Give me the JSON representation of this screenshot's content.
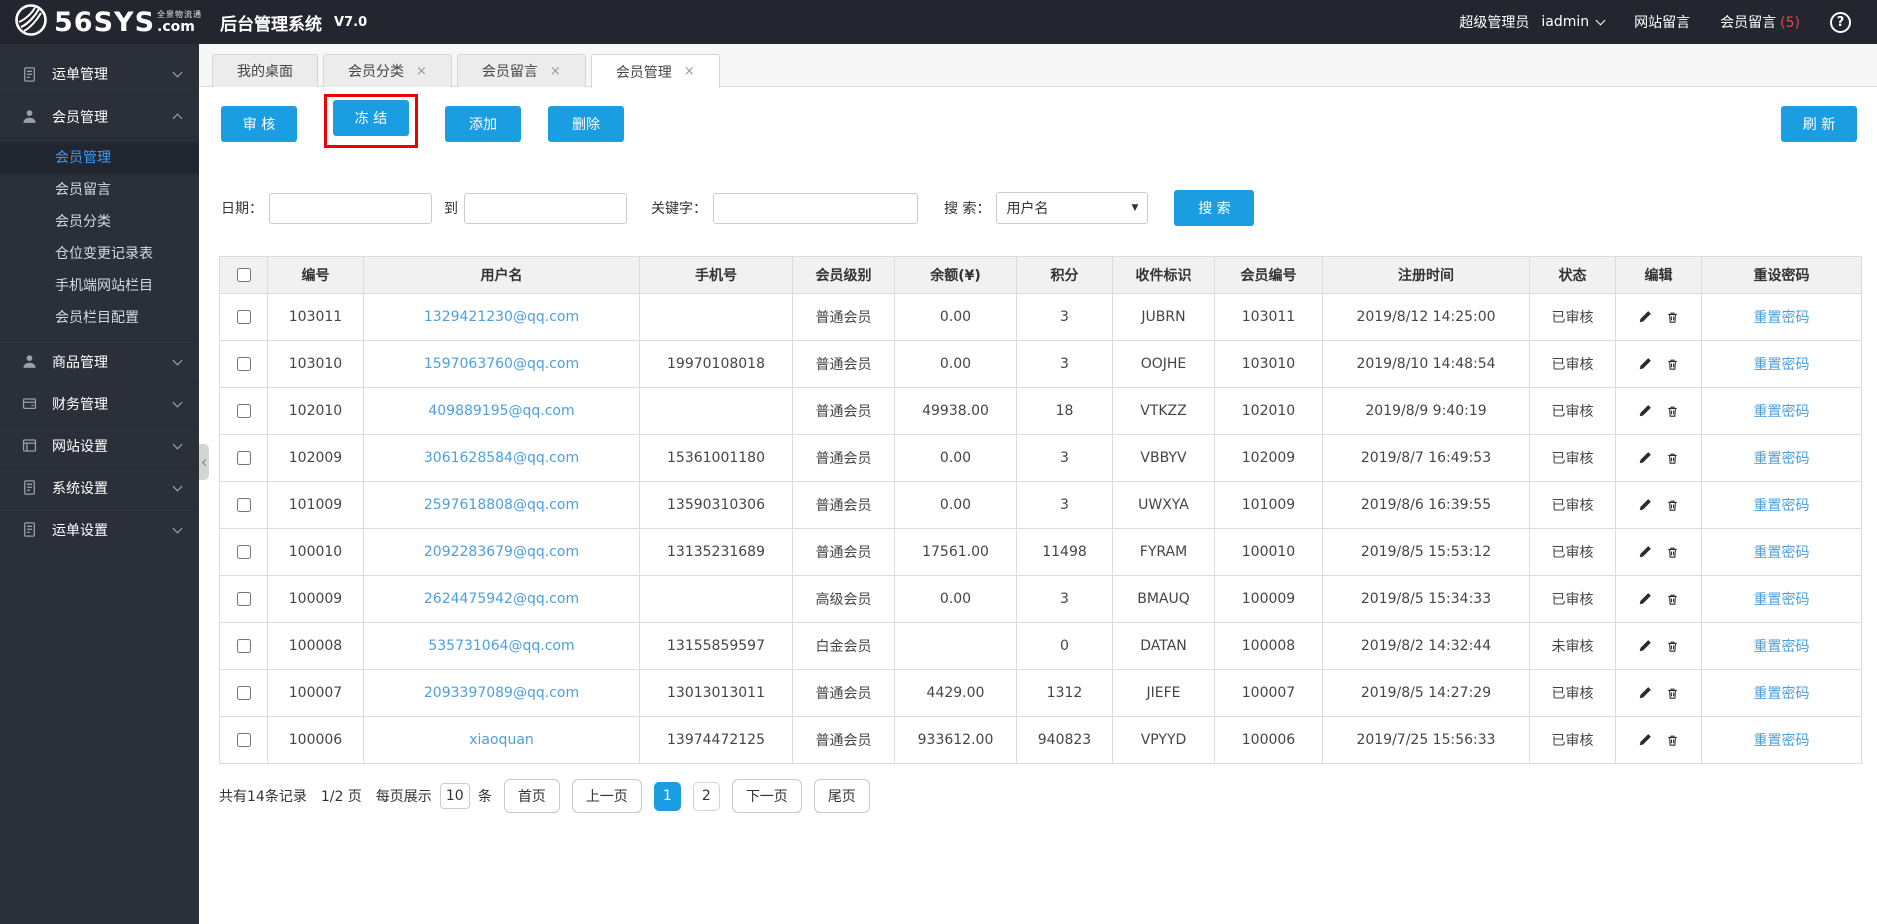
{
  "colors": {
    "accent_blue": "#1b9de2",
    "link_blue": "#4e9fdd",
    "annotation_red": "#f00000",
    "header_dark": "#23262e",
    "sidebar_dark": "#2b2f39",
    "active_menu_blue": "#3d9bf0",
    "count_red": "#e64545"
  },
  "header": {
    "logo_main": "56SYS",
    "logo_sub_top": "全景物流通",
    "logo_sub_bottom": ".com",
    "app_title": "后台管理系统",
    "version": "V7.0",
    "role": "超级管理员",
    "username": "iadmin",
    "site_messages": "网站留言",
    "member_messages": "会员留言",
    "member_messages_count": "(5)",
    "help": "?"
  },
  "sidebar": {
    "items": [
      {
        "label": "运单管理",
        "icon": "document-icon",
        "expanded": false
      },
      {
        "label": "会员管理",
        "icon": "user-icon",
        "expanded": true,
        "children": [
          {
            "label": "会员管理",
            "active": true
          },
          {
            "label": "会员留言",
            "active": false
          },
          {
            "label": "会员分类",
            "active": false
          },
          {
            "label": "仓位变更记录表",
            "active": false
          },
          {
            "label": "手机端网站栏目",
            "active": false
          },
          {
            "label": "会员栏目配置",
            "active": false
          }
        ]
      },
      {
        "label": "商品管理",
        "icon": "user-icon",
        "expanded": false
      },
      {
        "label": "财务管理",
        "icon": "wallet-icon",
        "expanded": false
      },
      {
        "label": "网站设置",
        "icon": "browser-icon",
        "expanded": false
      },
      {
        "label": "系统设置",
        "icon": "document-icon",
        "expanded": false
      },
      {
        "label": "运单设置",
        "icon": "document-icon",
        "expanded": false
      }
    ]
  },
  "tabs": [
    {
      "label": "我的桌面",
      "closable": false,
      "active": false
    },
    {
      "label": "会员分类",
      "closable": true,
      "active": false
    },
    {
      "label": "会员留言",
      "closable": true,
      "active": false
    },
    {
      "label": "会员管理",
      "closable": true,
      "active": true
    }
  ],
  "toolbar": {
    "audit": "审 核",
    "freeze": "冻 结",
    "add": "添加",
    "delete": "删除",
    "refresh": "刷 新"
  },
  "filters": {
    "date_label": "日期：",
    "to_label": "到",
    "keyword_label": "关键字：",
    "search_by_label": "搜 索：",
    "search_select_value": "用户名",
    "search_button": "搜 索"
  },
  "table": {
    "columns": [
      "编号",
      "用户名",
      "手机号",
      "会员级别",
      "余额(¥)",
      "积分",
      "收件标识",
      "会员编号",
      "注册时间",
      "状态",
      "编辑",
      "重设密码"
    ],
    "reset_link_label": "重置密码",
    "rows": [
      {
        "id": "103011",
        "username": "1329421230@qq.com",
        "phone": "",
        "level": "普通会员",
        "balance": "0.00",
        "points": "3",
        "code": "JUBRN",
        "member_id": "103011",
        "reg_time": "2019/8/12 14:25:00",
        "status": "已审核"
      },
      {
        "id": "103010",
        "username": "1597063760@qq.com",
        "phone": "19970108018",
        "level": "普通会员",
        "balance": "0.00",
        "points": "3",
        "code": "OOJHE",
        "member_id": "103010",
        "reg_time": "2019/8/10 14:48:54",
        "status": "已审核"
      },
      {
        "id": "102010",
        "username": "409889195@qq.com",
        "phone": "",
        "level": "普通会员",
        "balance": "49938.00",
        "points": "18",
        "code": "VTKZZ",
        "member_id": "102010",
        "reg_time": "2019/8/9 9:40:19",
        "status": "已审核"
      },
      {
        "id": "102009",
        "username": "3061628584@qq.com",
        "phone": "15361001180",
        "level": "普通会员",
        "balance": "0.00",
        "points": "3",
        "code": "VBBYV",
        "member_id": "102009",
        "reg_time": "2019/8/7 16:49:53",
        "status": "已审核"
      },
      {
        "id": "101009",
        "username": "2597618808@qq.com",
        "phone": "13590310306",
        "level": "普通会员",
        "balance": "0.00",
        "points": "3",
        "code": "UWXYA",
        "member_id": "101009",
        "reg_time": "2019/8/6 16:39:55",
        "status": "已审核"
      },
      {
        "id": "100010",
        "username": "2092283679@qq.com",
        "phone": "13135231689",
        "level": "普通会员",
        "balance": "17561.00",
        "points": "11498",
        "code": "FYRAM",
        "member_id": "100010",
        "reg_time": "2019/8/5 15:53:12",
        "status": "已审核"
      },
      {
        "id": "100009",
        "username": "2624475942@qq.com",
        "phone": "",
        "level": "高级会员",
        "balance": "0.00",
        "points": "3",
        "code": "BMAUQ",
        "member_id": "100009",
        "reg_time": "2019/8/5 15:34:33",
        "status": "已审核"
      },
      {
        "id": "100008",
        "username": "535731064@qq.com",
        "phone": "13155859597",
        "level": "白金会员",
        "balance": "",
        "points": "0",
        "code": "DATAN",
        "member_id": "100008",
        "reg_time": "2019/8/2 14:32:44",
        "status": "未审核"
      },
      {
        "id": "100007",
        "username": "2093397089@qq.com",
        "phone": "13013013011",
        "level": "普通会员",
        "balance": "4429.00",
        "points": "1312",
        "code": "JIEFE",
        "member_id": "100007",
        "reg_time": "2019/8/5 14:27:29",
        "status": "已审核"
      },
      {
        "id": "100006",
        "username": "xiaoquan",
        "phone": "13974472125",
        "level": "普通会员",
        "balance": "933612.00",
        "points": "940823",
        "code": "VPYYD",
        "member_id": "100006",
        "reg_time": "2019/7/25 15:56:33",
        "status": "已审核"
      }
    ]
  },
  "pagination": {
    "total_text": "共有14条记录",
    "page_text": "1/2 页",
    "per_page_prefix": "每页展示",
    "per_page_value": "10",
    "per_page_suffix": "条",
    "first": "首页",
    "prev": "上一页",
    "pages": [
      "1",
      "2"
    ],
    "active_page": "1",
    "next": "下一页",
    "last": "尾页"
  }
}
